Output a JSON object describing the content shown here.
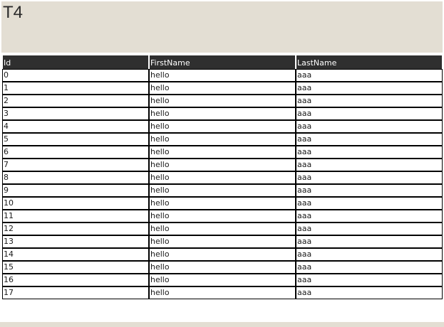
{
  "header": {
    "title": "T4"
  },
  "grid": {
    "columns": [
      "Id",
      "FirstName",
      "LastName"
    ],
    "rows": [
      [
        "0",
        "hello",
        "aaa"
      ],
      [
        "1",
        "hello",
        "aaa"
      ],
      [
        "2",
        "hello",
        "aaa"
      ],
      [
        "3",
        "hello",
        "aaa"
      ],
      [
        "4",
        "hello",
        "aaa"
      ],
      [
        "5",
        "hello",
        "aaa"
      ],
      [
        "6",
        "hello",
        "aaa"
      ],
      [
        "7",
        "hello",
        "aaa"
      ],
      [
        "8",
        "hello",
        "aaa"
      ],
      [
        "9",
        "hello",
        "aaa"
      ],
      [
        "10",
        "hello",
        "aaa"
      ],
      [
        "11",
        "hello",
        "aaa"
      ],
      [
        "12",
        "hello",
        "aaa"
      ],
      [
        "13",
        "hello",
        "aaa"
      ],
      [
        "14",
        "hello",
        "aaa"
      ],
      [
        "15",
        "hello",
        "aaa"
      ],
      [
        "16",
        "hello",
        "aaa"
      ],
      [
        "17",
        "hello",
        "aaa"
      ]
    ]
  },
  "colors": {
    "header_background": "#e3ded3",
    "grid_header_background": "#2f2f2f",
    "grid_header_text": "#ffffff",
    "cell_border": "#000000"
  }
}
